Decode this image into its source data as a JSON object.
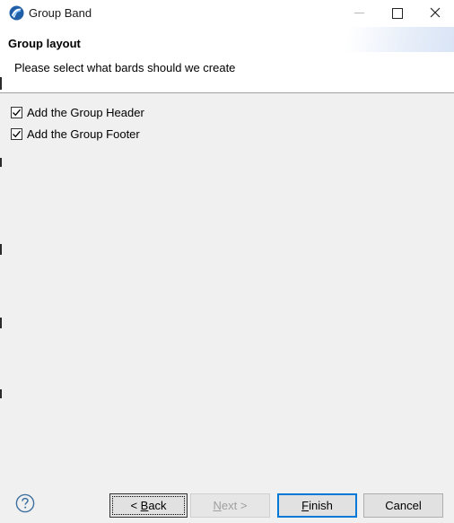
{
  "window": {
    "title": "Group Band",
    "icon": "eclipse-birt-icon"
  },
  "header": {
    "title": "Group layout",
    "description": "Please select what bards should we create"
  },
  "options": [
    {
      "label": "Add the Group Header",
      "checked": true
    },
    {
      "label": "Add the Group Footer",
      "checked": true
    }
  ],
  "buttons": {
    "back": {
      "prefix": "< ",
      "mnemonic": "B",
      "rest": "ack",
      "enabled": true
    },
    "next": {
      "mnemonic": "N",
      "rest": "ext",
      "suffix": " >",
      "enabled": false
    },
    "finish": {
      "mnemonic": "F",
      "rest": "inish",
      "enabled": true
    },
    "cancel": {
      "label": "Cancel",
      "enabled": true
    }
  },
  "colors": {
    "accent": "#0078d7",
    "content_bg": "#f0f0f0",
    "help_icon": "#3c6fa0"
  }
}
